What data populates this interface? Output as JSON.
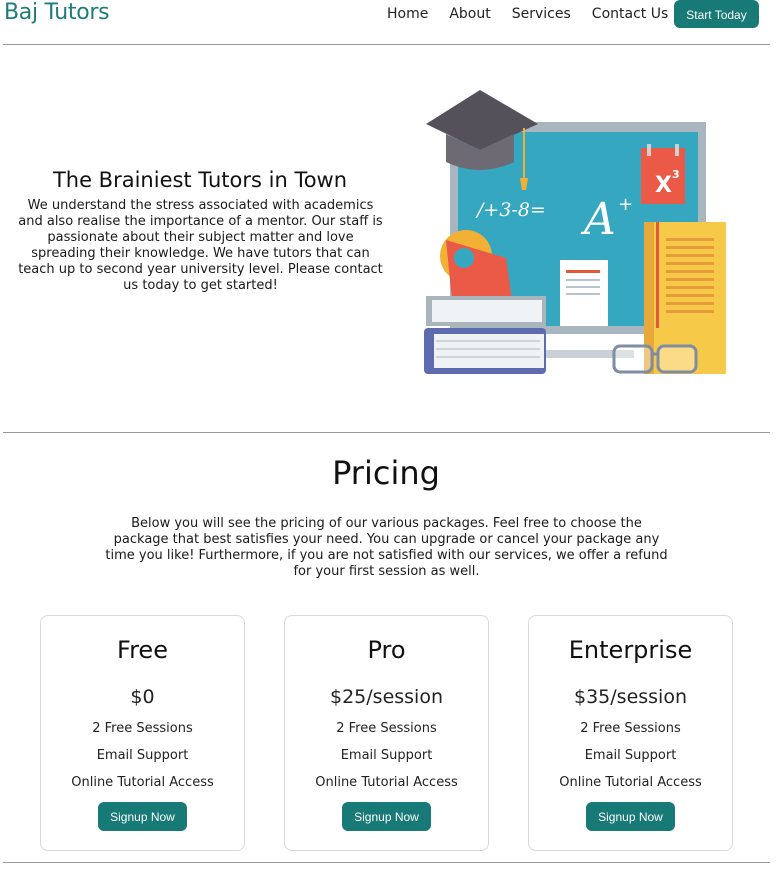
{
  "header": {
    "brand": "Baj Tutors",
    "nav": [
      "Home",
      "About",
      "Services",
      "Contact Us"
    ],
    "cta_label": "Start Today"
  },
  "hero": {
    "title": "The Brainiest Tutors in Town",
    "text": "We understand the stress associated with academics and also realise the importance of a mentor. Our staff is passionate about their subject matter and love spreading their knowledge. We have tutors that can teach up to second year university level. Please contact us today to get started!",
    "illustration": {
      "board_formula": "/+3-8=",
      "board_letter": "A",
      "board_plus": "+",
      "calendar_text": "X",
      "calendar_sup": "3"
    }
  },
  "pricing": {
    "title": "Pricing",
    "description": "Below you will see the pricing of our various packages. Feel free to choose the package that best satisfies your need. You can upgrade or cancel your package any time you like! Furthermore, if you are not satisfied with our services, we offer a refund for your first session as well.",
    "plans": [
      {
        "name": "Free",
        "price": "$0",
        "features": [
          "2 Free Sessions",
          "Email Support",
          "Online Tutorial Access"
        ],
        "button": "Signup Now"
      },
      {
        "name": "Pro",
        "price": "$25/session",
        "features": [
          "2 Free Sessions",
          "Email Support",
          "Online Tutorial Access"
        ],
        "button": "Signup Now"
      },
      {
        "name": "Enterprise",
        "price": "$35/session",
        "features": [
          "2 Free Sessions",
          "Email Support",
          "Online Tutorial Access"
        ],
        "button": "Signup Now"
      }
    ]
  },
  "colors": {
    "brand": "#1e7c7b",
    "button": "#177a76",
    "divider": "#9a9a9a"
  }
}
